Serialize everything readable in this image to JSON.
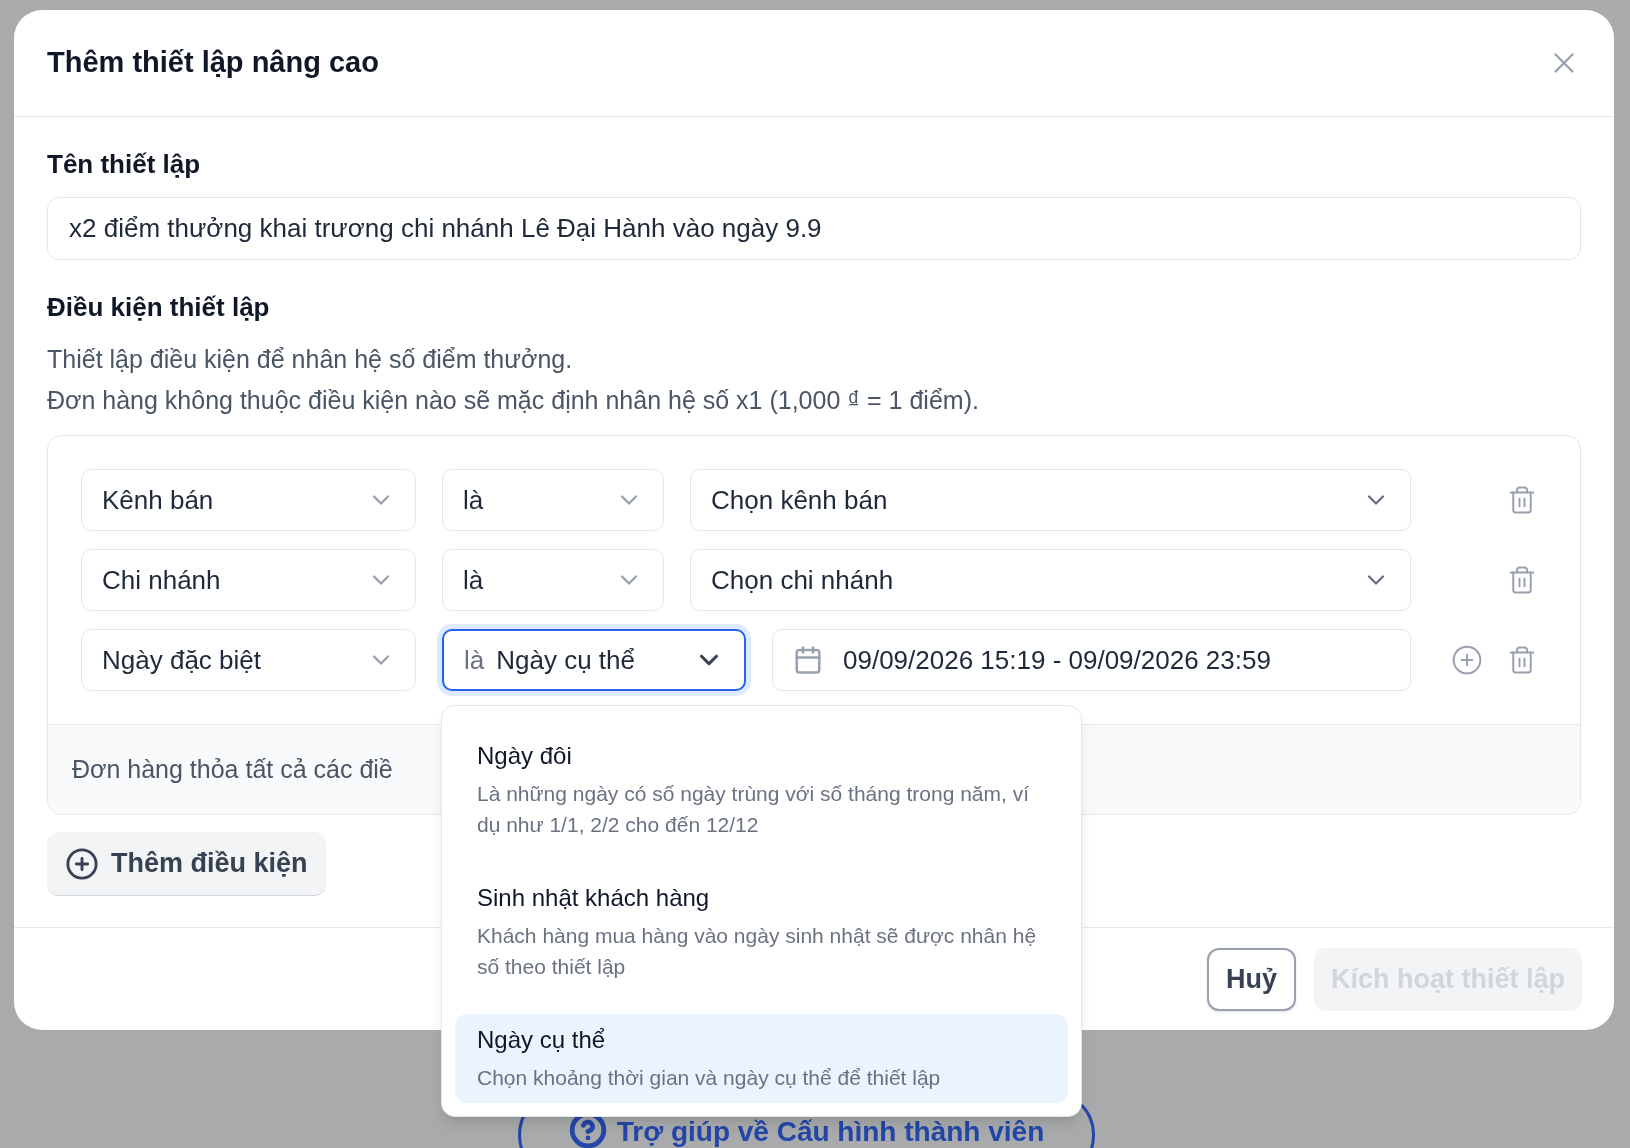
{
  "background": {
    "help_button": "Trợ giúp về Cấu hình thành viên"
  },
  "dialog": {
    "title": "Thêm thiết lập nâng cao"
  },
  "name_field": {
    "label": "Tên thiết lập",
    "value": "x2 điểm thưởng khai trương chi nhánh Lê Đại Hành vào ngày 9.9"
  },
  "conditions": {
    "heading": "Điều kiện thiết lập",
    "description": [
      "Thiết lập điều kiện để nhân hệ số điểm thưởng.",
      "Đơn hàng không thuộc điều kiện nào sẽ mặc định nhân hệ số x1 (1,000 ₫ = 1 điểm)."
    ],
    "rows": [
      {
        "kind": "select",
        "field": "Kênh bán",
        "operator": "là",
        "value": "Chọn kênh bán",
        "focused": false
      },
      {
        "kind": "select",
        "field": "Chi nhánh",
        "operator": "là",
        "value": "Chọn chi nhánh",
        "focused": false
      },
      {
        "kind": "date",
        "field": "Ngày đặc biệt",
        "operator_prefix": "là",
        "operator": "Ngày cụ thể",
        "value": "09/09/2026 15:19 - 09/09/2026 23:59",
        "focused": true
      }
    ],
    "footer_text": "Đơn hàng thỏa tất cả các điề",
    "add_button": "Thêm điều kiện"
  },
  "buttons": [
    {
      "label": "Huỷ",
      "disabled": false
    },
    {
      "label": "Kích hoạt thiết lập",
      "disabled": true
    }
  ],
  "dropdown": {
    "options": [
      {
        "title": "Ngày đôi",
        "description": "Là những ngày có số ngày trùng với số tháng trong năm, ví dụ như 1/1, 2/2 cho đến 12/12",
        "selected": false
      },
      {
        "title": "Sinh nhật khách hàng",
        "description": "Khách hàng mua hàng vào ngày sinh nhật sẽ được nhân hệ số theo thiết lập",
        "selected": false
      },
      {
        "title": "Ngày cụ thể",
        "description": "Chọn khoảng thời gian và ngày cụ thể để thiết lập",
        "selected": true
      }
    ]
  }
}
